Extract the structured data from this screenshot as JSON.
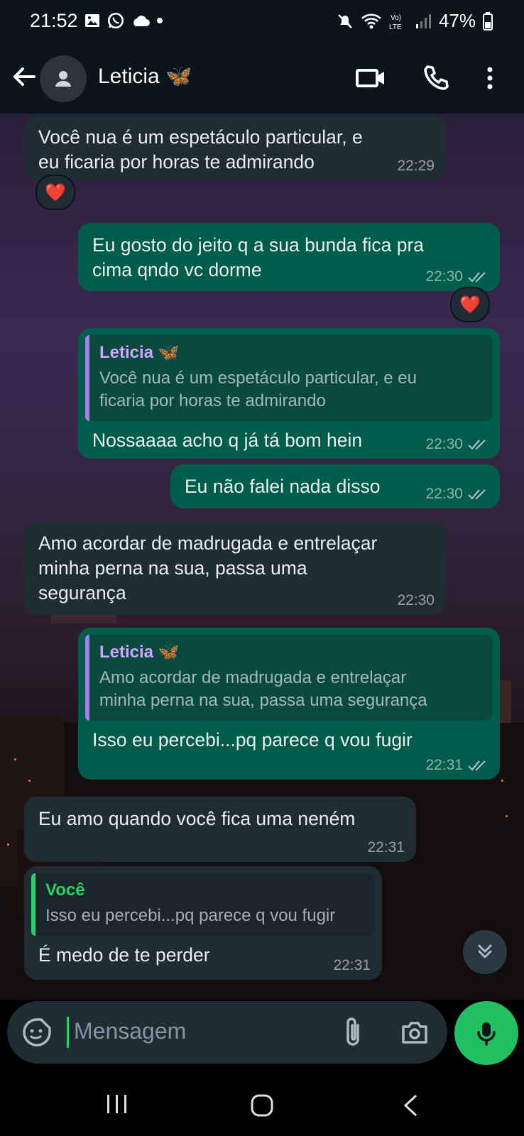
{
  "status_bar": {
    "time": "21:52",
    "battery": "47%"
  },
  "header": {
    "contact_name": "Leticia 🦋"
  },
  "messages": [
    {
      "text": "Você nua é um espetáculo particular, e\neu ficaria por horas te admirando",
      "time": "22:29",
      "reaction": "❤️"
    },
    {
      "text": "Eu gosto do jeito q a sua bunda fica pra\ncima qndo vc dorme",
      "time": "22:30",
      "reaction": "❤️"
    },
    {
      "quote_name": "Leticia 🦋",
      "quote_text": "Você nua é um espetáculo particular, e eu\nficaria por horas te admirando",
      "text": "Nossaaaa acho q já tá bom hein",
      "time": "22:30"
    },
    {
      "text": "Eu não falei nada disso",
      "time": "22:30"
    },
    {
      "text": "Amo acordar de madrugada e entrelaçar\nminha perna na sua, passa uma\nsegurança",
      "time": "22:30"
    },
    {
      "quote_name": "Leticia 🦋",
      "quote_text": "Amo acordar de madrugada e entrelaçar\nminha perna na sua, passa uma segurança",
      "text": "Isso eu percebi...pq parece q vou fugir",
      "time": "22:31"
    },
    {
      "text": "Eu amo quando você fica uma neném",
      "time": "22:31"
    },
    {
      "quote_name": "Você",
      "quote_text": "Isso eu percebi...pq parece q vou fugir",
      "text": "É medo de te perder",
      "time": "22:31"
    }
  ],
  "input": {
    "placeholder": "Mensagem"
  },
  "colors": {
    "incoming": "#202c33",
    "outgoing": "#005c4b",
    "accent": "#25d366"
  }
}
